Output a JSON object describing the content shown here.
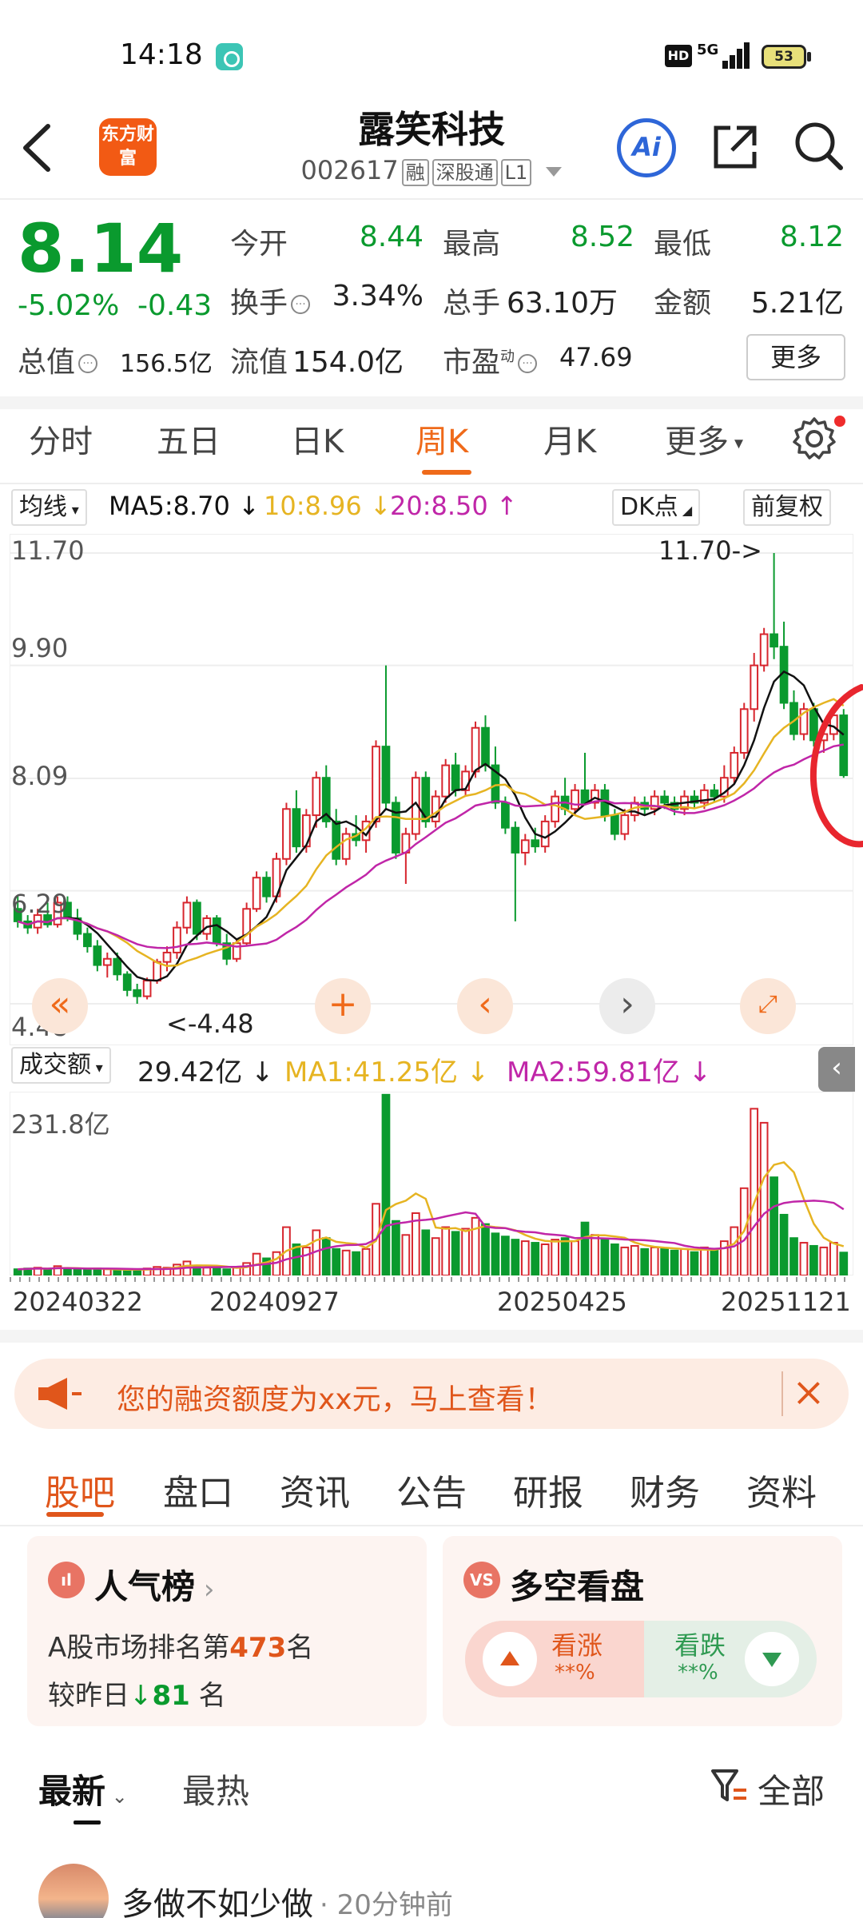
{
  "status_bar": {
    "time": "14:18",
    "network": "5G",
    "battery": "53"
  },
  "header": {
    "brand": "东方财富",
    "stock_name": "露笑科技",
    "stock_code": "002617",
    "tags": [
      "融",
      "深股通",
      "L1"
    ],
    "ai_label": "Ai"
  },
  "quote": {
    "price": "8.14",
    "change_pct": "-5.02%",
    "change_amt": "-0.43",
    "open_label": "今开",
    "open": "8.44",
    "high_label": "最高",
    "high": "8.52",
    "low_label": "最低",
    "low": "8.12",
    "turnover_label": "换手",
    "turnover": "3.34%",
    "volume_label": "总手",
    "volume": "63.10万",
    "amount_label": "金额",
    "amount": "5.21亿",
    "mktcap_label": "总值",
    "mktcap": "156.5亿",
    "float_label": "流值",
    "float_cap": "154.0亿",
    "pe_label": "市盈",
    "pe_sup": "动",
    "pe": "47.69",
    "more": "更多"
  },
  "period_tabs": [
    "分时",
    "五日",
    "日K",
    "周K",
    "月K",
    "更多"
  ],
  "active_period": "周K",
  "ma_legend": {
    "type": "均线",
    "ma5": "MA5:8.70",
    "ma10": "10:8.96",
    "ma20": "20:8.50",
    "dk": "DK点",
    "adjust": "前复权"
  },
  "kline": {
    "y_labels": [
      "11.70",
      "9.90",
      "8.09",
      "6.29",
      "4.48"
    ],
    "max_note": "11.70->",
    "min_note": "<-4.48"
  },
  "volume_legend": {
    "type": "成交额",
    "value": "29.42亿",
    "ma1": "MA1:41.25亿",
    "ma2": "MA2:59.81亿",
    "y_label": "231.8亿"
  },
  "dates": [
    "20240322",
    "20240927",
    "20250425",
    "20251121"
  ],
  "colors": {
    "up": "#d7262e",
    "down": "#0a9a2e",
    "ma5": "#111111",
    "ma10": "#e6b422",
    "ma20": "#c026a8",
    "accent": "#ef6a1a"
  },
  "chart_data": [
    {
      "type": "candlestick",
      "title": "周K",
      "ylim": [
        4.48,
        11.7
      ],
      "y_ticks": [
        11.7,
        9.9,
        8.09,
        6.29,
        4.48
      ],
      "x_tick_labels": [
        "20240322",
        "20240927",
        "20250425",
        "20251121"
      ],
      "ohlc": [
        [
          6.0,
          6.2,
          5.7,
          5.8
        ],
        [
          5.8,
          5.9,
          5.6,
          5.7
        ],
        [
          5.7,
          6.0,
          5.6,
          5.9
        ],
        [
          5.9,
          6.1,
          5.7,
          5.75
        ],
        [
          5.75,
          6.2,
          5.7,
          6.1
        ],
        [
          6.1,
          6.2,
          5.8,
          5.85
        ],
        [
          5.85,
          6.0,
          5.5,
          5.6
        ],
        [
          5.6,
          5.7,
          5.3,
          5.4
        ],
        [
          5.4,
          5.5,
          5.0,
          5.1
        ],
        [
          5.1,
          5.3,
          4.9,
          5.2
        ],
        [
          5.2,
          5.3,
          4.85,
          4.95
        ],
        [
          4.95,
          5.0,
          4.6,
          4.7
        ],
        [
          4.7,
          4.8,
          4.48,
          4.6
        ],
        [
          4.6,
          4.9,
          4.55,
          4.85
        ],
        [
          4.85,
          5.2,
          4.8,
          5.15
        ],
        [
          5.15,
          5.4,
          5.0,
          5.3
        ],
        [
          5.3,
          5.8,
          5.2,
          5.7
        ],
        [
          5.7,
          6.2,
          5.6,
          6.1
        ],
        [
          6.1,
          6.15,
          5.5,
          5.6
        ],
        [
          5.6,
          5.9,
          5.5,
          5.85
        ],
        [
          5.85,
          5.9,
          5.4,
          5.45
        ],
        [
          5.45,
          5.6,
          5.1,
          5.2
        ],
        [
          5.2,
          5.5,
          5.15,
          5.45
        ],
        [
          5.45,
          6.1,
          5.4,
          6.0
        ],
        [
          6.0,
          6.6,
          5.95,
          6.5
        ],
        [
          6.5,
          6.6,
          6.1,
          6.2
        ],
        [
          6.2,
          6.9,
          6.1,
          6.8
        ],
        [
          6.8,
          7.7,
          6.7,
          7.6
        ],
        [
          7.6,
          7.9,
          6.9,
          7.0
        ],
        [
          7.0,
          7.6,
          6.9,
          7.5
        ],
        [
          7.5,
          8.2,
          7.3,
          8.1
        ],
        [
          8.1,
          8.3,
          7.3,
          7.4
        ],
        [
          7.4,
          7.6,
          6.7,
          6.8
        ],
        [
          6.8,
          7.3,
          6.7,
          7.2
        ],
        [
          7.2,
          7.5,
          7.0,
          7.1
        ],
        [
          7.1,
          7.5,
          6.9,
          7.4
        ],
        [
          7.4,
          8.7,
          7.3,
          8.6
        ],
        [
          8.6,
          9.9,
          7.6,
          7.7
        ],
        [
          7.7,
          7.8,
          6.8,
          6.9
        ],
        [
          6.9,
          7.3,
          6.4,
          7.2
        ],
        [
          7.2,
          8.2,
          7.1,
          8.1
        ],
        [
          8.1,
          8.2,
          7.3,
          7.4
        ],
        [
          7.4,
          7.9,
          7.3,
          7.8
        ],
        [
          7.8,
          8.4,
          7.7,
          8.3
        ],
        [
          8.3,
          8.5,
          7.8,
          7.9
        ],
        [
          7.9,
          8.3,
          7.8,
          8.2
        ],
        [
          8.2,
          9.0,
          8.1,
          8.9
        ],
        [
          8.9,
          9.1,
          8.2,
          8.3
        ],
        [
          8.3,
          8.6,
          7.6,
          7.7
        ],
        [
          7.7,
          7.8,
          7.2,
          7.3
        ],
        [
          7.3,
          7.4,
          5.8,
          6.9
        ],
        [
          6.9,
          7.2,
          6.7,
          7.1
        ],
        [
          7.1,
          7.3,
          6.9,
          7.0
        ],
        [
          7.0,
          7.5,
          6.9,
          7.4
        ],
        [
          7.4,
          7.9,
          7.3,
          7.8
        ],
        [
          7.8,
          8.1,
          7.5,
          7.6
        ],
        [
          7.6,
          8.0,
          7.5,
          7.9
        ],
        [
          7.9,
          8.5,
          7.8,
          7.7
        ],
        [
          7.7,
          8.0,
          7.6,
          7.9
        ],
        [
          7.9,
          8.0,
          7.4,
          7.5
        ],
        [
          7.5,
          7.6,
          7.1,
          7.2
        ],
        [
          7.2,
          7.6,
          7.1,
          7.5
        ],
        [
          7.5,
          7.8,
          7.4,
          7.7
        ],
        [
          7.7,
          7.8,
          7.5,
          7.6
        ],
        [
          7.6,
          7.9,
          7.5,
          7.8
        ],
        [
          7.8,
          7.9,
          7.6,
          7.7
        ],
        [
          7.7,
          7.8,
          7.5,
          7.6
        ],
        [
          7.6,
          7.9,
          7.5,
          7.8
        ],
        [
          7.8,
          7.9,
          7.6,
          7.7
        ],
        [
          7.7,
          8.0,
          7.6,
          7.9
        ],
        [
          7.9,
          8.0,
          7.7,
          7.8
        ],
        [
          7.8,
          8.3,
          7.7,
          8.1
        ],
        [
          8.1,
          8.6,
          8.0,
          8.5
        ],
        [
          8.5,
          9.3,
          8.4,
          9.2
        ],
        [
          9.2,
          10.1,
          9.0,
          9.9
        ],
        [
          9.9,
          10.5,
          9.8,
          10.4
        ],
        [
          10.4,
          11.7,
          10.0,
          10.2
        ],
        [
          10.2,
          10.6,
          9.2,
          9.3
        ],
        [
          9.3,
          9.5,
          8.7,
          8.8
        ],
        [
          8.8,
          9.3,
          8.7,
          9.2
        ],
        [
          9.2,
          9.3,
          8.6,
          8.7
        ],
        [
          8.7,
          8.9,
          8.5,
          8.8
        ],
        [
          8.8,
          9.2,
          8.7,
          9.1
        ],
        [
          9.1,
          9.2,
          8.1,
          8.14
        ]
      ],
      "ma5": "MA5:8.70",
      "ma10": "10:8.96",
      "ma20": "20:8.50",
      "max": "11.70",
      "min": "4.48"
    },
    {
      "type": "bar",
      "title": "成交额",
      "ylim": [
        0,
        231.8
      ],
      "unit": "亿",
      "values": [
        8,
        9,
        10,
        8,
        12,
        9,
        8,
        7,
        9,
        8,
        7,
        6,
        8,
        9,
        11,
        10,
        14,
        18,
        12,
        10,
        9,
        8,
        10,
        16,
        28,
        22,
        30,
        62,
        40,
        36,
        58,
        48,
        34,
        32,
        30,
        34,
        92,
        232,
        70,
        52,
        80,
        58,
        48,
        62,
        56,
        60,
        74,
        66,
        54,
        50,
        46,
        44,
        42,
        40,
        46,
        48,
        44,
        68,
        52,
        46,
        40,
        36,
        38,
        34,
        36,
        34,
        32,
        34,
        30,
        36,
        32,
        44,
        62,
        112,
        214,
        196,
        126,
        78,
        48,
        42,
        38,
        36,
        42,
        29.42
      ],
      "ma1": "MA1:41.25亿",
      "ma2": "MA2:59.81亿"
    }
  ],
  "promo": {
    "text": "您的融资额度为xx元，马上查看！"
  },
  "bottom_tabs": [
    "股吧",
    "盘口",
    "资讯",
    "公告",
    "研报",
    "财务",
    "资料"
  ],
  "active_bottom_tab": "股吧",
  "popularity_card": {
    "badge": "ıl",
    "title": "人气榜",
    "rank_prefix": "A股市场排名第",
    "rank": "473",
    "rank_suffix": "名",
    "change_prefix": "较昨日",
    "change": "81",
    "change_suffix": "名"
  },
  "longshort_card": {
    "badge": "VS",
    "title": "多空看盘",
    "rise_label": "看涨",
    "rise_pct": "**%",
    "fall_label": "看跌",
    "fall_pct": "**%"
  },
  "feed_filter": {
    "latest": "最新",
    "hot": "最热",
    "all": "全部"
  },
  "post": {
    "author": "多做不如少做",
    "time": "· 20分钟前"
  }
}
